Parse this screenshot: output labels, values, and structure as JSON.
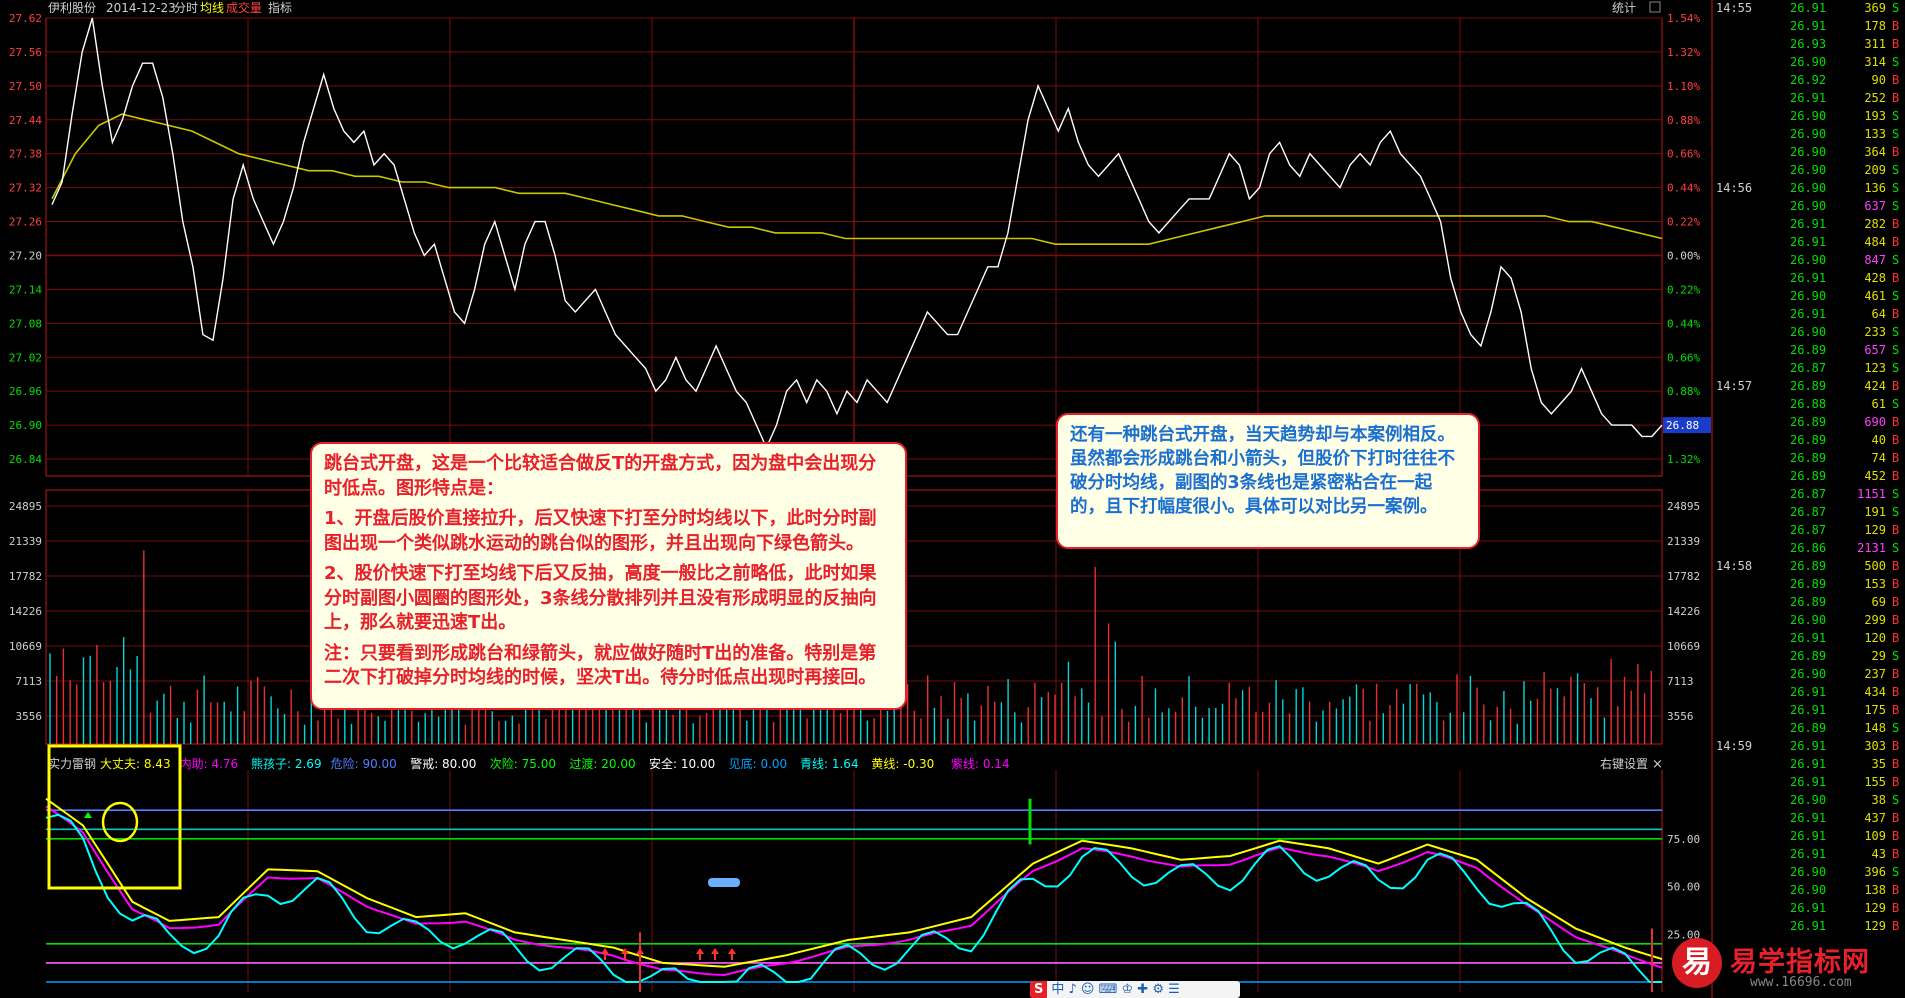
{
  "header": {
    "stock_name": "伊利股份",
    "date": "2014-12-23",
    "mode": "分时",
    "avg_label": "均线",
    "vol_label": "成交量",
    "indicator_label": "指标",
    "stats_label": "统计"
  },
  "last_price_tag": "26.88",
  "indicator_bar": {
    "name": "实力雷钢",
    "items": [
      {
        "label": "大丈夫:",
        "value": "8.43",
        "color": "#ffff00"
      },
      {
        "label": "内助:",
        "value": "4.76",
        "color": "#ff00ff"
      },
      {
        "label": "熊孩子:",
        "value": "2.69",
        "color": "#00ffff"
      },
      {
        "label": "危险:",
        "value": "90.00",
        "color": "#5080ff"
      },
      {
        "label": "警戒:",
        "value": "80.00",
        "color": "#ffffff"
      },
      {
        "label": "次险:",
        "value": "75.00",
        "color": "#00ff00"
      },
      {
        "label": "过渡:",
        "value": "20.00",
        "color": "#00ff00"
      },
      {
        "label": "安全:",
        "value": "10.00",
        "color": "#ffffff"
      },
      {
        "label": "见底:",
        "value": "0.00",
        "color": "#00a0ff"
      },
      {
        "label": "青线:",
        "value": "1.64",
        "color": "#00ffff"
      },
      {
        "label": "黄线:",
        "value": "-0.30",
        "color": "#ffff00"
      },
      {
        "label": "紫线:",
        "value": "0.14",
        "color": "#ff00ff"
      }
    ],
    "right_label": "右键设置",
    "close": "×"
  },
  "price_axis": {
    "left": [
      "27.62",
      "27.56",
      "27.50",
      "27.44",
      "27.38",
      "27.32",
      "27.26",
      "27.20",
      "27.14",
      "27.08",
      "27.02",
      "26.96",
      "26.90",
      "26.84"
    ],
    "right": [
      "1.54%",
      "1.32%",
      "1.10%",
      "0.88%",
      "0.66%",
      "0.44%",
      "0.22%",
      "0.00%",
      "0.22%",
      "0.44%",
      "0.66%",
      "0.88%",
      "1.10%",
      "1.32%"
    ]
  },
  "volume_axis": [
    "24895",
    "21339",
    "17782",
    "14226",
    "10669",
    "7113",
    "3556"
  ],
  "indicator_axis": [
    "75.00",
    "50.00",
    "25.00"
  ],
  "ticks": [
    {
      "time": "14:55",
      "price": "26.91",
      "vol": "369",
      "side": "S"
    },
    {
      "time": "",
      "price": "26.91",
      "vol": "178",
      "side": "B"
    },
    {
      "time": "",
      "price": "26.93",
      "vol": "311",
      "side": "B"
    },
    {
      "time": "",
      "price": "26.90",
      "vol": "314",
      "side": "S"
    },
    {
      "time": "",
      "price": "26.92",
      "vol": "90",
      "side": "B"
    },
    {
      "time": "",
      "price": "26.91",
      "vol": "252",
      "side": "B"
    },
    {
      "time": "",
      "price": "26.90",
      "vol": "193",
      "side": "S"
    },
    {
      "time": "",
      "price": "26.90",
      "vol": "133",
      "side": "S"
    },
    {
      "time": "",
      "price": "26.90",
      "vol": "364",
      "side": "B"
    },
    {
      "time": "",
      "price": "26.90",
      "vol": "209",
      "side": "S"
    },
    {
      "time": "14:56",
      "price": "26.90",
      "vol": "136",
      "side": "S"
    },
    {
      "time": "",
      "price": "26.90",
      "vol": "637",
      "side": "S"
    },
    {
      "time": "",
      "price": "26.91",
      "vol": "282",
      "side": "B"
    },
    {
      "time": "",
      "price": "26.91",
      "vol": "484",
      "side": "B"
    },
    {
      "time": "",
      "price": "26.90",
      "vol": "847",
      "side": "S"
    },
    {
      "time": "",
      "price": "26.91",
      "vol": "428",
      "side": "B"
    },
    {
      "time": "",
      "price": "26.90",
      "vol": "461",
      "side": "S"
    },
    {
      "time": "",
      "price": "26.91",
      "vol": "64",
      "side": "B"
    },
    {
      "time": "",
      "price": "26.90",
      "vol": "233",
      "side": "S"
    },
    {
      "time": "",
      "price": "26.89",
      "vol": "657",
      "side": "S"
    },
    {
      "time": "",
      "price": "26.87",
      "vol": "123",
      "side": "S"
    },
    {
      "time": "14:57",
      "price": "26.89",
      "vol": "424",
      "side": "B"
    },
    {
      "time": "",
      "price": "26.88",
      "vol": "61",
      "side": "S"
    },
    {
      "time": "",
      "price": "26.89",
      "vol": "690",
      "side": "B"
    },
    {
      "time": "",
      "price": "26.89",
      "vol": "40",
      "side": "B"
    },
    {
      "time": "",
      "price": "26.89",
      "vol": "74",
      "side": "B"
    },
    {
      "time": "",
      "price": "26.89",
      "vol": "452",
      "side": "B"
    },
    {
      "time": "",
      "price": "26.87",
      "vol": "1151",
      "side": "S"
    },
    {
      "time": "",
      "price": "26.87",
      "vol": "191",
      "side": "S"
    },
    {
      "time": "",
      "price": "26.87",
      "vol": "129",
      "side": "B"
    },
    {
      "time": "",
      "price": "26.86",
      "vol": "2131",
      "side": "S"
    },
    {
      "time": "14:58",
      "price": "26.89",
      "vol": "500",
      "side": "B"
    },
    {
      "time": "",
      "price": "26.89",
      "vol": "153",
      "side": "B"
    },
    {
      "time": "",
      "price": "26.89",
      "vol": "69",
      "side": "B"
    },
    {
      "time": "",
      "price": "26.90",
      "vol": "299",
      "side": "B"
    },
    {
      "time": "",
      "price": "26.91",
      "vol": "120",
      "side": "B"
    },
    {
      "time": "",
      "price": "26.89",
      "vol": "29",
      "side": "S"
    },
    {
      "time": "",
      "price": "26.90",
      "vol": "237",
      "side": "B"
    },
    {
      "time": "",
      "price": "26.91",
      "vol": "434",
      "side": "B"
    },
    {
      "time": "",
      "price": "26.91",
      "vol": "175",
      "side": "B"
    },
    {
      "time": "",
      "price": "26.89",
      "vol": "148",
      "side": "S"
    },
    {
      "time": "14:59",
      "price": "26.91",
      "vol": "303",
      "side": "B"
    },
    {
      "time": "",
      "price": "26.91",
      "vol": "35",
      "side": "B"
    },
    {
      "time": "",
      "price": "26.91",
      "vol": "155",
      "side": "B"
    },
    {
      "time": "",
      "price": "26.90",
      "vol": "38",
      "side": "S"
    },
    {
      "time": "",
      "price": "26.91",
      "vol": "437",
      "side": "B"
    },
    {
      "time": "",
      "price": "26.91",
      "vol": "109",
      "side": "B"
    },
    {
      "time": "",
      "price": "26.91",
      "vol": "43",
      "side": "B"
    },
    {
      "time": "",
      "price": "26.90",
      "vol": "396",
      "side": "S"
    },
    {
      "time": "",
      "price": "26.90",
      "vol": "138",
      "side": "B"
    },
    {
      "time": "",
      "price": "26.91",
      "vol": "129",
      "side": "B"
    },
    {
      "time": "",
      "price": "26.91",
      "vol": "129",
      "side": "B"
    }
  ],
  "callout_left": [
    "跳台式开盘，这是一个比较适合做反T的开盘方式，因为盘中会出现分时低点。图形特点是：",
    "1、开盘后股价直接拉升，后又快速下打至分时均线以下，此时分时副图出现一个类似跳水运动的跳台似的图形，并且出现向下绿色箭头。",
    "2、股价快速下打至均线下后又反抽，高度一般比之前略低，此时如果分时副图小圆圈的图形处，3条线分散排列并且没有形成明显的反抽向上，那么就要迅速T出。",
    "注：只要看到形成跳台和绿箭头，就应做好随时T出的准备。特别是第二次下打破掉分时均线的时候，坚决T出。待分时低点出现时再接回。"
  ],
  "callout_right": "还有一种跳台式开盘，当天趋势却与本案例相反。虽然都会形成跳台和小箭头，但股价下打时往往不破分时均线，副图的3条线也是紧密粘合在一起的，且下打幅度很小。具体可以对比另一案例。",
  "watermark": {
    "logo_char": "易",
    "site_name": "易学指标网",
    "url": "www.16696.com"
  },
  "toolbar_items": "中 ♪ ☺ ⌨ ♔ ✚ ⚙ ☰",
  "chart_data": {
    "type": "line",
    "prev_close": 27.2,
    "ylim": [
      26.84,
      27.62
    ],
    "price": [
      27.29,
      27.33,
      27.45,
      27.56,
      27.62,
      27.5,
      27.4,
      27.44,
      27.5,
      27.54,
      27.54,
      27.48,
      27.38,
      27.26,
      27.18,
      27.06,
      27.05,
      27.16,
      27.3,
      27.36,
      27.3,
      27.26,
      27.22,
      27.26,
      27.32,
      27.4,
      27.46,
      27.52,
      27.46,
      27.42,
      27.4,
      27.42,
      27.36,
      27.38,
      27.36,
      27.3,
      27.24,
      27.2,
      27.22,
      27.16,
      27.1,
      27.08,
      27.14,
      27.22,
      27.26,
      27.2,
      27.14,
      27.22,
      27.26,
      27.26,
      27.2,
      27.12,
      27.1,
      27.12,
      27.14,
      27.1,
      27.06,
      27.04,
      27.02,
      27.0,
      26.96,
      26.98,
      27.02,
      26.98,
      26.96,
      27.0,
      27.04,
      27.0,
      26.96,
      26.94,
      26.9,
      26.86,
      26.9,
      26.96,
      26.98,
      26.94,
      26.98,
      26.96,
      26.92,
      26.96,
      26.94,
      26.98,
      26.96,
      26.94,
      26.98,
      27.02,
      27.06,
      27.1,
      27.08,
      27.06,
      27.06,
      27.1,
      27.14,
      27.18,
      27.18,
      27.24,
      27.34,
      27.44,
      27.5,
      27.46,
      27.42,
      27.46,
      27.4,
      27.36,
      27.34,
      27.36,
      27.38,
      27.34,
      27.3,
      27.26,
      27.24,
      27.26,
      27.28,
      27.3,
      27.3,
      27.3,
      27.34,
      27.38,
      27.36,
      27.3,
      27.32,
      27.38,
      27.4,
      27.36,
      27.34,
      27.38,
      27.36,
      27.34,
      27.32,
      27.36,
      27.38,
      27.36,
      27.4,
      27.42,
      27.38,
      27.36,
      27.34,
      27.3,
      27.26,
      27.16,
      27.1,
      27.06,
      27.04,
      27.1,
      27.18,
      27.16,
      27.1,
      27.0,
      26.94,
      26.92,
      26.94,
      26.96,
      27.0,
      26.96,
      26.92,
      26.9,
      26.9,
      26.9,
      26.88,
      26.88,
      26.9
    ],
    "avg": [
      27.3,
      27.38,
      27.43,
      27.45,
      27.44,
      27.43,
      27.42,
      27.4,
      27.38,
      27.37,
      27.36,
      27.35,
      27.35,
      27.34,
      27.34,
      27.33,
      27.33,
      27.32,
      27.32,
      27.32,
      27.31,
      27.31,
      27.31,
      27.3,
      27.29,
      27.28,
      27.27,
      27.27,
      27.26,
      27.25,
      27.25,
      27.24,
      27.24,
      27.24,
      27.23,
      27.23,
      27.23,
      27.23,
      27.23,
      27.23,
      27.23,
      27.23,
      27.23,
      27.22,
      27.22,
      27.22,
      27.22,
      27.22,
      27.23,
      27.24,
      27.25,
      27.26,
      27.27,
      27.27,
      27.27,
      27.27,
      27.27,
      27.27,
      27.27,
      27.27,
      27.27,
      27.27,
      27.27,
      27.27,
      27.27,
      27.26,
      27.26,
      27.25,
      27.24,
      27.23
    ],
    "volume_ylim": [
      0,
      28000
    ],
    "indicator_ylim": [
      0,
      100
    ],
    "indicator_series": [
      {
        "name": "大丈夫",
        "color": "#ffff00"
      },
      {
        "name": "内助",
        "color": "#ff00ff"
      },
      {
        "name": "熊孩子",
        "color": "#00ffff"
      }
    ],
    "indicator_levels": [
      90,
      80,
      75,
      20,
      10,
      0
    ]
  }
}
